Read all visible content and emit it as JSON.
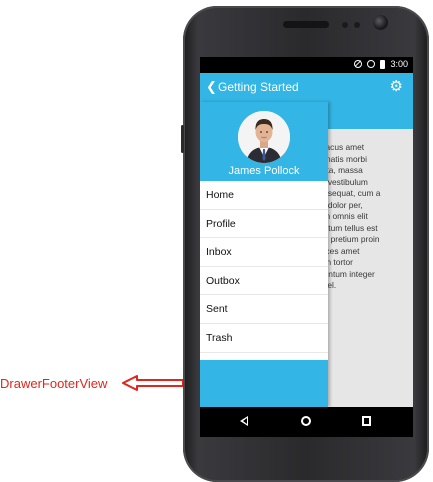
{
  "action_bar": {
    "back_icon": "chevron-left",
    "title": "Getting Started",
    "settings_icon": "gear"
  },
  "status_bar": {
    "time": "3:00",
    "icons": [
      "do-not-disturb",
      "alarm",
      "battery"
    ]
  },
  "drawer": {
    "user_name": "James Pollock",
    "avatar": "profile-photo",
    "menu_items": [
      {
        "label": "Home"
      },
      {
        "label": "Profile"
      },
      {
        "label": "Inbox"
      },
      {
        "label": "Outbox"
      },
      {
        "label": "Sent"
      },
      {
        "label": "Trash"
      }
    ]
  },
  "content": {
    "text": "et, lacus amet\nenenatis morbi\n porta, massa\norci vestibulum\n consequat, cum a\na in dolor per,\nnd in omnis elit\nmentum tellus est\narcu pretium proin\nultrices amet\norem tortor\nementum integer\nus vel."
  },
  "nav_bar": {
    "back_icon": "triangle-back",
    "home_icon": "circle-home",
    "recent_icon": "square-recent"
  },
  "annotation": {
    "label": "DrawerFooterView",
    "color": "#e0261d"
  },
  "colors": {
    "accent": "#33b5e5",
    "content_background": "#e6e6e6"
  }
}
